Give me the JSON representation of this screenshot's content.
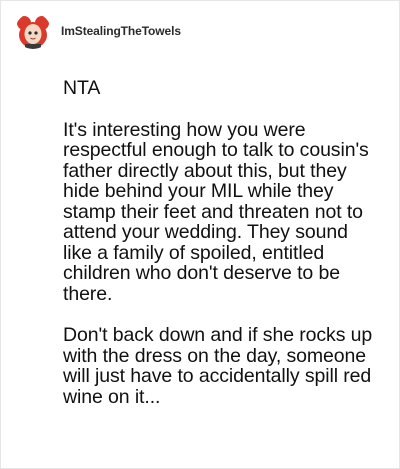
{
  "post": {
    "username": "ImStealingTheTowels",
    "avatar_icon": "cartoon-avatar-icon",
    "paragraphs": [
      "NTA",
      "It's interesting how you were respectful enough to talk to cousin's father directly about this, but they hide behind your MIL while they stamp their feet and threaten not to attend your wedding. They sound like a family of spoiled, entitled children who don't deserve to be there.",
      "Don't back down and if she rocks up with the dress on the day, someone will just have to accidentally spill red wine on it..."
    ]
  },
  "colors": {
    "avatar_red": "#d93a2b",
    "avatar_skin": "#f3d9c4",
    "text": "#111111",
    "username": "#2b2b2b",
    "border": "#e6e6e6"
  }
}
